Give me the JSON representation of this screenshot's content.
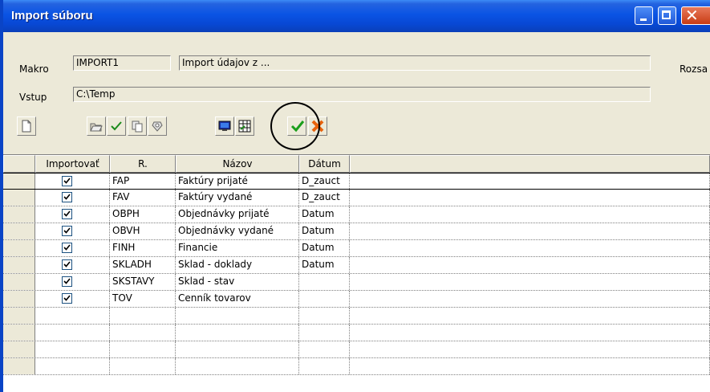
{
  "window": {
    "title": "Import súboru"
  },
  "form": {
    "makro_label": "Makro",
    "makro_code": "IMPORT1",
    "makro_desc": "Import údajov z ...",
    "range_label": "Rozsa",
    "vstup_label": "Vstup",
    "vstup_value": "C:\\Temp"
  },
  "toolbar": [
    "new-document-icon",
    "open-folder-icon",
    "checkmark-icon",
    "copy-icon",
    "settings-icon",
    "monitor-icon",
    "table-export-icon",
    "confirm-icon",
    "cancel-icon"
  ],
  "grid": {
    "columns": [
      "Importovať",
      "R.",
      "Názov",
      "Dátum"
    ],
    "rows": [
      {
        "checked": true,
        "r": "FAP",
        "name": "Faktúry prijaté",
        "date": "D_zauct"
      },
      {
        "checked": true,
        "r": "FAV",
        "name": "Faktúry vydané",
        "date": "D_zauct"
      },
      {
        "checked": true,
        "r": "OBPH",
        "name": "Objednávky prijaté",
        "date": "Datum"
      },
      {
        "checked": true,
        "r": "OBVH",
        "name": "Objednávky vydané",
        "date": "Datum"
      },
      {
        "checked": true,
        "r": "FINH",
        "name": "Financie",
        "date": "Datum"
      },
      {
        "checked": true,
        "r": "SKLADH",
        "name": "Sklad - doklady",
        "date": "Datum"
      },
      {
        "checked": true,
        "r": "SKSTAVY",
        "name": "Sklad - stav",
        "date": ""
      },
      {
        "checked": true,
        "r": "TOV",
        "name": "Cenník tovarov",
        "date": ""
      }
    ]
  },
  "colors": {
    "title_bar": "#0a54e4",
    "face": "#ece9d8",
    "confirm": "#1a9e1a",
    "cancel": "#e8620c"
  }
}
